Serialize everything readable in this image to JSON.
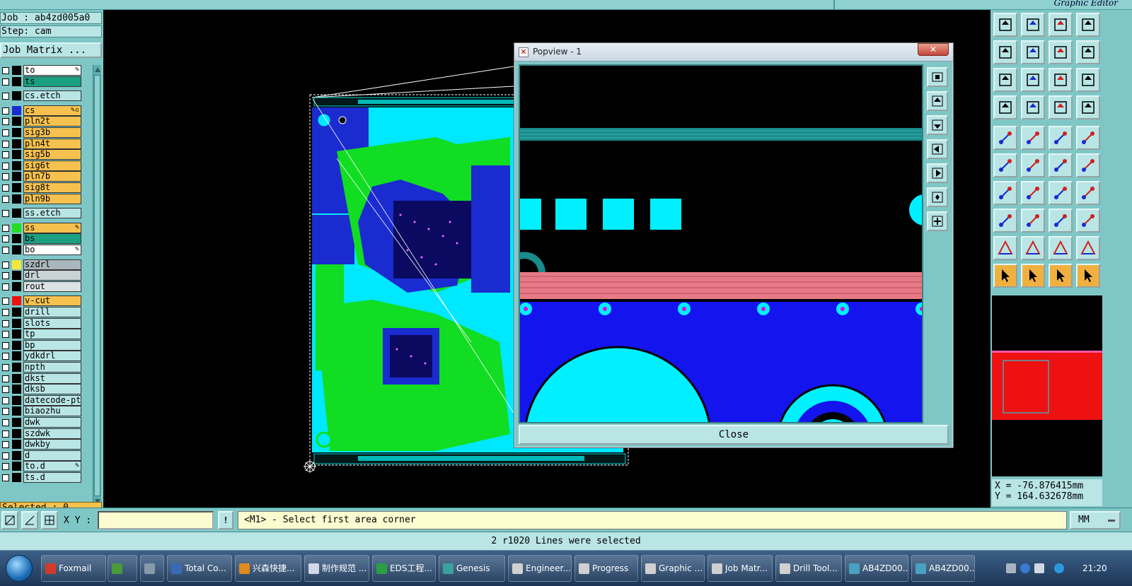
{
  "app": {
    "right_title": "Graphic Editor"
  },
  "left_panel": {
    "job": "Job : ab4zd005a0",
    "step": "Step: cam",
    "job_matrix": "Job Matrix ...",
    "selected": "Selected : 0",
    "layers": [
      {
        "name": "to",
        "color": "#ffffff",
        "swatch": "#000000",
        "mark": "✎"
      },
      {
        "name": "ts",
        "color": "#1aa080",
        "swatch": "#000000",
        "mark": ""
      },
      {
        "name": "cs.etch",
        "color": "#b9e5e5",
        "swatch": "#000000",
        "mark": "",
        "gap": true
      },
      {
        "name": "cs",
        "color": "#f6c14e",
        "swatch": "#1a2bd0",
        "mark": "✎▫",
        "gap": true
      },
      {
        "name": "pln2t",
        "color": "#f6c14e",
        "swatch": "#000000",
        "mark": ""
      },
      {
        "name": "sig3b",
        "color": "#f6c14e",
        "swatch": "#000000",
        "mark": ""
      },
      {
        "name": "pln4t",
        "color": "#f6c14e",
        "swatch": "#000000",
        "mark": ""
      },
      {
        "name": "sig5b",
        "color": "#f6c14e",
        "swatch": "#000000",
        "mark": ""
      },
      {
        "name": "sig6t",
        "color": "#f6c14e",
        "swatch": "#000000",
        "mark": ""
      },
      {
        "name": "pln7b",
        "color": "#f6c14e",
        "swatch": "#000000",
        "mark": ""
      },
      {
        "name": "sig8t",
        "color": "#f6c14e",
        "swatch": "#000000",
        "mark": ""
      },
      {
        "name": "pln9b",
        "color": "#f6c14e",
        "swatch": "#000000",
        "mark": ""
      },
      {
        "name": "ss.etch",
        "color": "#b9e5e5",
        "swatch": "#000000",
        "mark": "",
        "gap": true
      },
      {
        "name": "ss",
        "color": "#f6c14e",
        "swatch": "#22dd22",
        "mark": "✎",
        "gap": true
      },
      {
        "name": "bs",
        "color": "#1aa080",
        "swatch": "#000000",
        "mark": ""
      },
      {
        "name": "bo",
        "color": "#ffffff",
        "swatch": "#000000",
        "mark": "✎"
      },
      {
        "name": "szdrl",
        "color": "#a9b7bd",
        "swatch": "#f5e63a",
        "mark": "",
        "gap": true
      },
      {
        "name": "drl",
        "color": "#c9d3d6",
        "swatch": "#000000",
        "mark": ""
      },
      {
        "name": "rout",
        "color": "#dde3e5",
        "swatch": "#000000",
        "mark": ""
      },
      {
        "name": "v-cut",
        "color": "#f6c14e",
        "swatch": "#ee1111",
        "mark": "",
        "gap": true
      },
      {
        "name": "drill",
        "color": "#b9e5e5",
        "swatch": "#000000",
        "mark": ""
      },
      {
        "name": "slots",
        "color": "#b9e5e5",
        "swatch": "#000000",
        "mark": ""
      },
      {
        "name": "tp",
        "color": "#b9e5e5",
        "swatch": "#000000",
        "mark": ""
      },
      {
        "name": "bp",
        "color": "#b9e5e5",
        "swatch": "#000000",
        "mark": ""
      },
      {
        "name": "ydkdrl",
        "color": "#b9e5e5",
        "swatch": "#000000",
        "mark": ""
      },
      {
        "name": "npth",
        "color": "#b9e5e5",
        "swatch": "#000000",
        "mark": ""
      },
      {
        "name": "dkst",
        "color": "#b9e5e5",
        "swatch": "#000000",
        "mark": ""
      },
      {
        "name": "dksb",
        "color": "#b9e5e5",
        "swatch": "#000000",
        "mark": ""
      },
      {
        "name": "datecode-pte",
        "color": "#b9e5e5",
        "swatch": "#000000",
        "mark": ""
      },
      {
        "name": "biaozhu",
        "color": "#b9e5e5",
        "swatch": "#000000",
        "mark": ""
      },
      {
        "name": "dwk",
        "color": "#b9e5e5",
        "swatch": "#000000",
        "mark": ""
      },
      {
        "name": "szdwk",
        "color": "#b9e5e5",
        "swatch": "#000000",
        "mark": ""
      },
      {
        "name": "dwkby",
        "color": "#b9e5e5",
        "swatch": "#000000",
        "mark": ""
      },
      {
        "name": "d",
        "color": "#b9e5e5",
        "swatch": "#000000",
        "mark": ""
      },
      {
        "name": "to.d",
        "color": "#b9e5e5",
        "swatch": "#000000",
        "mark": "✎"
      },
      {
        "name": "ts.d",
        "color": "#b9e5e5",
        "swatch": "#000000",
        "mark": ""
      }
    ]
  },
  "popview": {
    "title": "Popview - 1",
    "close_x": "✕",
    "close_label": "Close"
  },
  "right_panel": {
    "coord_x": "X = -76.876415mm",
    "coord_y": "Y = 164.632678mm"
  },
  "command_bar": {
    "xy_label": "X Y :",
    "xy_value": "",
    "warn": "!",
    "message": "<M1> - Select first area corner",
    "units": "MM"
  },
  "status": {
    "message": "2 r1020 Lines were selected"
  },
  "taskbar": {
    "items": [
      {
        "label": "Foxmail",
        "color": "#d23b2a"
      },
      {
        "label": "",
        "color": "#4a9a3a"
      },
      {
        "label": "",
        "color": "#8899aa"
      },
      {
        "label": "Total Co...",
        "color": "#3a6ab8"
      },
      {
        "label": "兴森快捷...",
        "color": "#e08a20"
      },
      {
        "label": "制作规范 ...",
        "color": "#d0d8e8"
      },
      {
        "label": "EDS工程...",
        "color": "#2aa040"
      },
      {
        "label": "Genesis",
        "color": "#3aa0a0"
      },
      {
        "label": "Engineer...",
        "color": "#d0d0d0"
      },
      {
        "label": "Progress",
        "color": "#d0d0d0"
      },
      {
        "label": "Graphic ...",
        "color": "#d0d0d0"
      },
      {
        "label": "Job Matr...",
        "color": "#d0d0d0"
      },
      {
        "label": "Drill Tool...",
        "color": "#d0d0d0"
      },
      {
        "label": "AB4ZD00...",
        "color": "#4aa0c0"
      },
      {
        "label": "AB4ZD00...",
        "color": "#4aa0c0"
      }
    ],
    "clock": "21:20"
  }
}
